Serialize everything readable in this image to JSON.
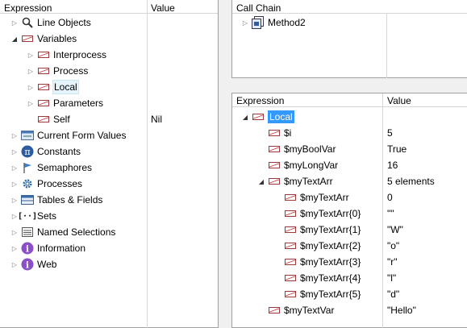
{
  "left": {
    "col_expression": "Expression",
    "col_value": "Value",
    "items": [
      {
        "label": "Line Objects",
        "icon": "search-icon",
        "value": ""
      },
      {
        "label": "Variables",
        "icon": "variable-icon",
        "value": ""
      },
      {
        "label": "Interprocess",
        "icon": "variable-icon",
        "value": ""
      },
      {
        "label": "Process",
        "icon": "variable-icon",
        "value": ""
      },
      {
        "label": "Local",
        "icon": "variable-icon",
        "value": ""
      },
      {
        "label": "Parameters",
        "icon": "variable-icon",
        "value": ""
      },
      {
        "label": "Self",
        "icon": "variable-icon",
        "value": "Nil"
      },
      {
        "label": "Current Form Values",
        "icon": "form-icon",
        "value": ""
      },
      {
        "label": "Constants",
        "icon": "pi-icon",
        "value": ""
      },
      {
        "label": "Semaphores",
        "icon": "flag-icon",
        "value": ""
      },
      {
        "label": "Processes",
        "icon": "gear-icon",
        "value": ""
      },
      {
        "label": "Tables & Fields",
        "icon": "table-icon",
        "value": ""
      },
      {
        "label": "Sets",
        "icon": "set-icon",
        "value": ""
      },
      {
        "label": "Named Selections",
        "icon": "list-icon",
        "value": ""
      },
      {
        "label": "Information",
        "icon": "info-icon",
        "value": ""
      },
      {
        "label": "Web",
        "icon": "info-icon",
        "value": ""
      }
    ]
  },
  "callchain": {
    "header": "Call Chain",
    "items": [
      {
        "label": "Method2",
        "icon": "method-icon"
      }
    ]
  },
  "right": {
    "col_expression": "Expression",
    "col_value": "Value",
    "items": [
      {
        "label": "Local",
        "value": ""
      },
      {
        "label": "$i",
        "value": "5"
      },
      {
        "label": "$myBoolVar",
        "value": "True"
      },
      {
        "label": "$myLongVar",
        "value": "16"
      },
      {
        "label": "$myTextArr",
        "value": "5 elements"
      },
      {
        "label": "$myTextArr",
        "value": "0"
      },
      {
        "label": "$myTextArr{0}",
        "value": "\"\""
      },
      {
        "label": "$myTextArr{1}",
        "value": "\"W\""
      },
      {
        "label": "$myTextArr{2}",
        "value": "\"o\""
      },
      {
        "label": "$myTextArr{3}",
        "value": "\"r\""
      },
      {
        "label": "$myTextArr{4}",
        "value": "\"l\""
      },
      {
        "label": "$myTextArr{5}",
        "value": "\"d\""
      },
      {
        "label": "$myTextVar",
        "value": "\"Hello\""
      }
    ]
  }
}
